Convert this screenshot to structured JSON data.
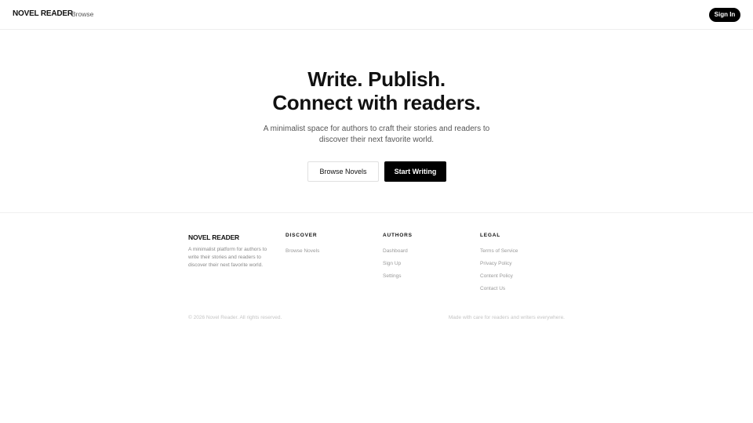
{
  "header": {
    "brand": "NOVEL READER",
    "nav_browse": "Browse",
    "sign_in": "Sign In"
  },
  "hero": {
    "title_line1": "Write. Publish.",
    "title_line2": "Connect with readers.",
    "subtitle_line1": "A minimalist space for authors to craft their stories and readers to",
    "subtitle_line2": "discover their next favorite world.",
    "browse_button": "Browse Novels",
    "start_button": "Start Writing"
  },
  "footer": {
    "brand": "NOVEL READER",
    "description_line1": "A minimalist platform for authors to",
    "description_line2": "write their stories and readers to",
    "description_line3": "discover their next favorite world.",
    "columns": [
      {
        "heading": "DISCOVER",
        "links": [
          "Browse Novels"
        ]
      },
      {
        "heading": "AUTHORS",
        "links": [
          "Dashboard",
          "Sign Up",
          "Settings"
        ]
      },
      {
        "heading": "LEGAL",
        "links": [
          "Terms of Service",
          "Privacy Policy",
          "Content Policy",
          "Contact Us"
        ]
      }
    ],
    "copyright": "© 2026 Novel Reader. All rights reserved.",
    "made_with": "Made with care for readers and writers everywhere."
  },
  "colors": {
    "primary": "#000000",
    "text": "#111111",
    "muted": "#888888",
    "border": "#eeeeee"
  }
}
